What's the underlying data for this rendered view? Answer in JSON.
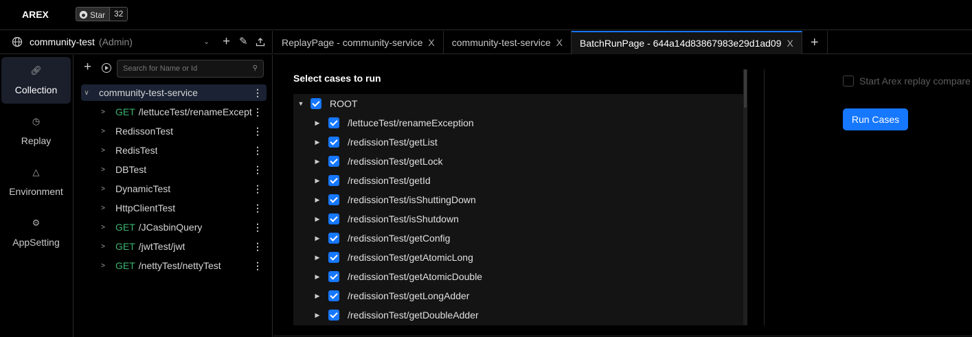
{
  "app": {
    "brand": "AREX",
    "github_star_label": "Star",
    "github_star_count": "32"
  },
  "workspace": {
    "name": "community-test",
    "role": "(Admin)"
  },
  "tabs": [
    {
      "label": "ReplayPage - community-service",
      "close": "X"
    },
    {
      "label": "community-test-service",
      "close": "X"
    },
    {
      "label": "BatchRunPage - 644a14d83867983e29d1ad09",
      "close": "X"
    }
  ],
  "nav": [
    {
      "label": "Collection",
      "icon": "link-icon"
    },
    {
      "label": "Replay",
      "icon": "clock-icon"
    },
    {
      "label": "Environment",
      "icon": "nodes-icon"
    },
    {
      "label": "AppSetting",
      "icon": "gear-icon"
    }
  ],
  "collection": {
    "search_placeholder": "Search for Name or Id",
    "root": "community-test-service",
    "items": [
      {
        "method": "GET",
        "label": "/lettuceTest/renameExcept"
      },
      {
        "method": "",
        "label": "RedissonTest"
      },
      {
        "method": "",
        "label": "RedisTest"
      },
      {
        "method": "",
        "label": "DBTest"
      },
      {
        "method": "",
        "label": "DynamicTest"
      },
      {
        "method": "",
        "label": "HttpClientTest"
      },
      {
        "method": "GET",
        "label": "/JCasbinQuery"
      },
      {
        "method": "GET",
        "label": "/jwtTest/jwt"
      },
      {
        "method": "GET",
        "label": "/nettyTest/nettyTest"
      }
    ]
  },
  "batch": {
    "heading": "Select cases to run",
    "root_label": "ROOT",
    "cases": [
      "/lettuceTest/renameException",
      "/redissionTest/getList",
      "/redissionTest/getLock",
      "/redissionTest/getId",
      "/redissionTest/isShuttingDown",
      "/redissionTest/isShutdown",
      "/redissionTest/getConfig",
      "/redissionTest/getAtomicLong",
      "/redissionTest/getAtomicDouble",
      "/redissionTest/getLongAdder",
      "/redissionTest/getDoubleAdder"
    ],
    "compare_label": "Start Arex replay compare",
    "compare_checked": false,
    "run_button": "Run Cases"
  },
  "colors": {
    "accent": "#1677ff",
    "get_method": "#3cb371"
  }
}
